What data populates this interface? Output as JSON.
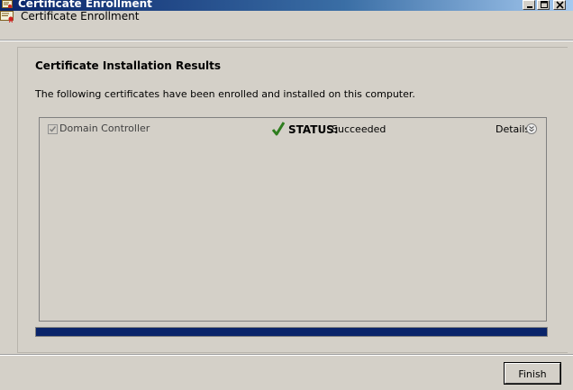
{
  "window": {
    "title": "Certificate Enrollment",
    "icon": "certificate-icon",
    "controls": [
      "minimize-icon",
      "maximize-icon",
      "close-icon"
    ]
  },
  "header": {
    "title": "Certificate Enrollment",
    "icon": "certificate-icon"
  },
  "page": {
    "heading": "Certificate Installation Results",
    "description": "The following certificates have been enrolled and installed on this computer."
  },
  "certificates": [
    {
      "name": "Domain Controller",
      "checked": true,
      "status_label": "STATUS:",
      "status_value": "Succeeded",
      "status_icon": "green-checkmark-icon",
      "details_label": "Details",
      "details_icon": "expand-chevron-icon"
    }
  ],
  "progress": {
    "fraction": 1.0,
    "color": "#0a246a"
  },
  "footer": {
    "finish_label": "Finish"
  }
}
